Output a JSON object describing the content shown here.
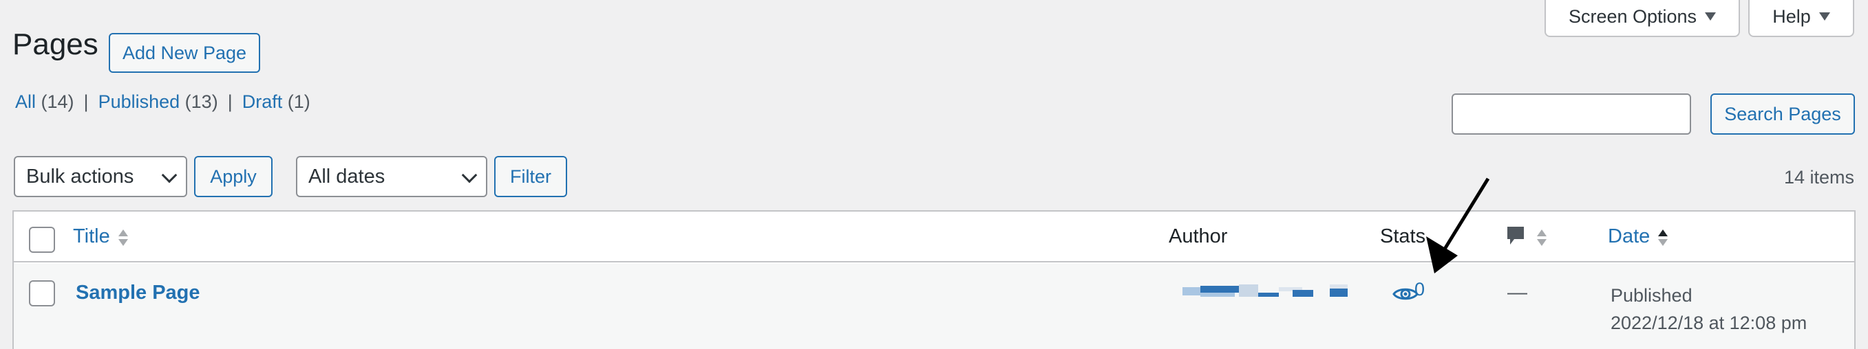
{
  "header": {
    "screen_options": "Screen Options",
    "help": "Help"
  },
  "page": {
    "title": "Pages",
    "add_new": "Add New Page"
  },
  "filters": {
    "all_label": "All",
    "all_count": "(14)",
    "published_label": "Published",
    "published_count": "(13)",
    "draft_label": "Draft",
    "draft_count": "(1)",
    "separator": "|"
  },
  "search": {
    "placeholder": "",
    "button": "Search Pages"
  },
  "toolbar": {
    "bulk_actions": "Bulk actions",
    "apply": "Apply",
    "all_dates": "All dates",
    "filter": "Filter",
    "items_count": "14 items"
  },
  "table": {
    "columns": {
      "title": "Title",
      "author": "Author",
      "stats": "Stats",
      "date": "Date"
    },
    "rows": [
      {
        "title": "Sample Page",
        "stats_views": "0",
        "comments": "—",
        "status": "Published",
        "date": "2022/12/18 at 12:08 pm"
      }
    ]
  },
  "colors": {
    "accent": "#2271b1",
    "background": "#f0f0f1",
    "text": "#1d2327"
  }
}
